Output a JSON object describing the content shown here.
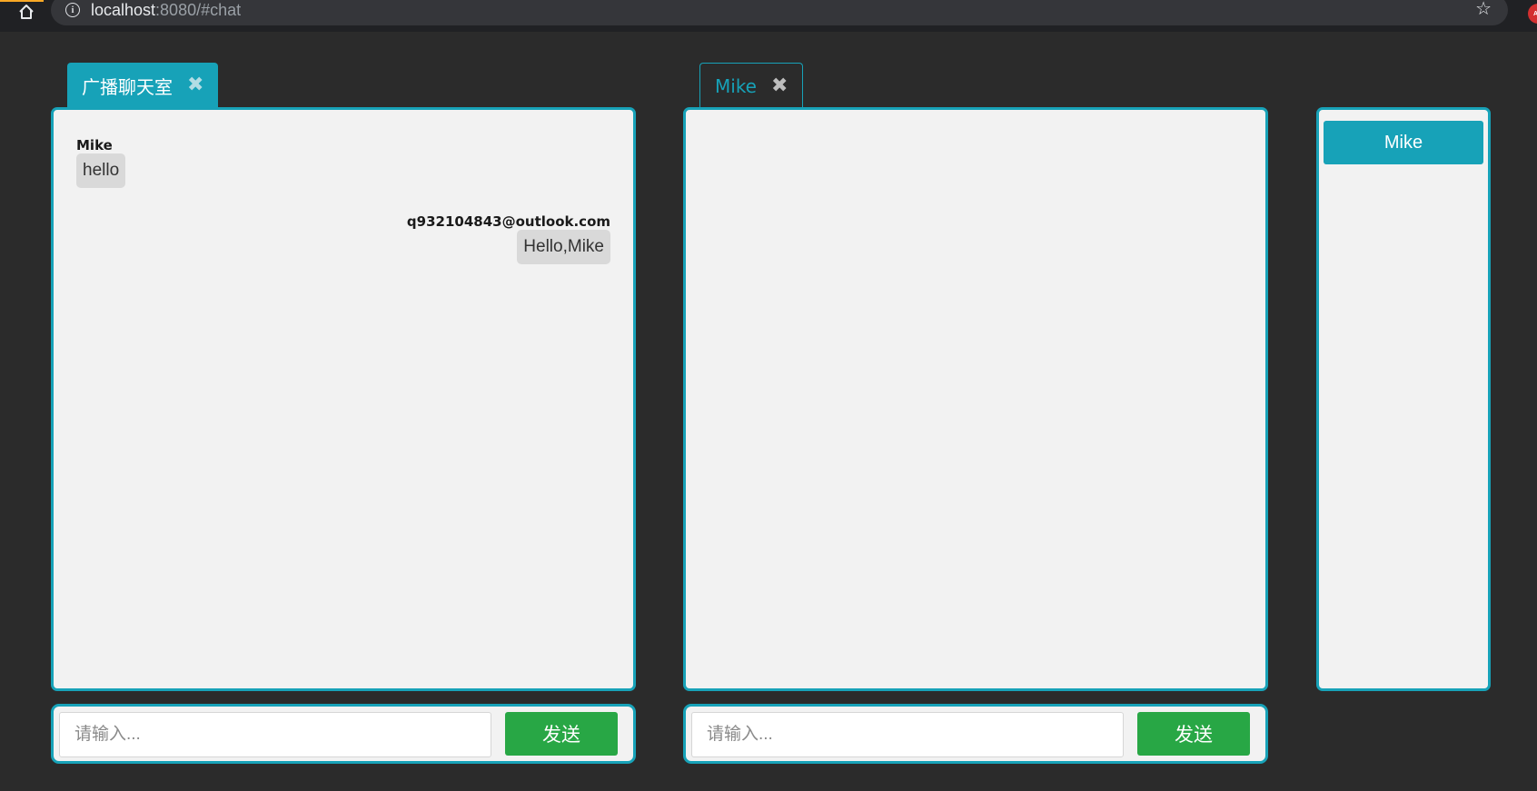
{
  "browser": {
    "url_host": "localhost",
    "url_rest": ":8080/#chat",
    "info_glyph": "i",
    "ext_badge": "AB",
    "star_glyph": "☆",
    "home_glyph": "⌂"
  },
  "broadcast_room": {
    "tab_label": "广播聊天室",
    "close_glyph": "✖",
    "messages": [
      {
        "sender": "Mike",
        "text": "hello",
        "side": "left"
      },
      {
        "sender": "q932104843@outlook.com",
        "text": "Hello,Mike",
        "side": "right"
      }
    ],
    "input_placeholder": "请输入...",
    "send_label": "发送"
  },
  "private_room": {
    "tab_label": "Mike",
    "close_glyph": "✖",
    "messages": [],
    "input_placeholder": "请输入...",
    "send_label": "发送"
  },
  "user_list": {
    "users": [
      "Mike"
    ]
  },
  "colors": {
    "accent": "#17a2b8",
    "send_button": "#28a745",
    "background": "#2b2b2b",
    "panel": "#f2f2f2",
    "bubble": "#d9d9d9"
  }
}
